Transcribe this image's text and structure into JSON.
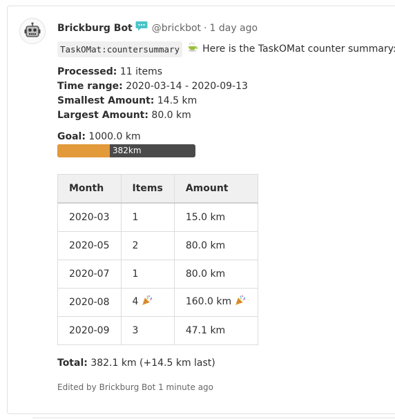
{
  "note": {
    "author": "Brickburg Bot",
    "handle": "@brickbot",
    "separator": "·",
    "time": "1 day ago",
    "command": "TaskOMat:countersummary",
    "intro": "Here is the TaskOMat counter summary:",
    "processed": {
      "label": "Processed:",
      "value": "11 items"
    },
    "time_range": {
      "label": "Time range:",
      "value": "2020-03-14 - 2020-09-13"
    },
    "smallest": {
      "label": "Smallest Amount:",
      "value": "14.5 km"
    },
    "largest": {
      "label": "Largest Amount:",
      "value": "80.0 km"
    },
    "goal": {
      "label": "Goal:",
      "value": "1000.0 km"
    },
    "progress": {
      "label": "382km",
      "fraction": 0.382
    },
    "table": {
      "headers": [
        "Month",
        "Items",
        "Amount"
      ],
      "rows": [
        {
          "month": "2020-03",
          "items": "1",
          "amount": "15.0 km",
          "items_party": false,
          "amount_party": false
        },
        {
          "month": "2020-05",
          "items": "2",
          "amount": "80.0 km",
          "items_party": false,
          "amount_party": false
        },
        {
          "month": "2020-07",
          "items": "1",
          "amount": "80.0 km",
          "items_party": false,
          "amount_party": false
        },
        {
          "month": "2020-08",
          "items": "4",
          "amount": "160.0 km",
          "items_party": true,
          "amount_party": true
        },
        {
          "month": "2020-09",
          "items": "3",
          "amount": "47.1 km",
          "items_party": false,
          "amount_party": false
        }
      ]
    },
    "total": {
      "label": "Total:",
      "value": "382.1 km (+14.5 km last)"
    },
    "edited": "Edited by Brickburg Bot 1 minute ago",
    "icons": {
      "avatar": "robot-icon",
      "badge": "bot-chat-icon",
      "cup": "tea-cup-icon",
      "party": "party-popper-icon"
    },
    "colors": {
      "progress_fill": "#e29a3b",
      "progress_track": "#4a4a4a",
      "badge": "#48c4c8"
    }
  }
}
